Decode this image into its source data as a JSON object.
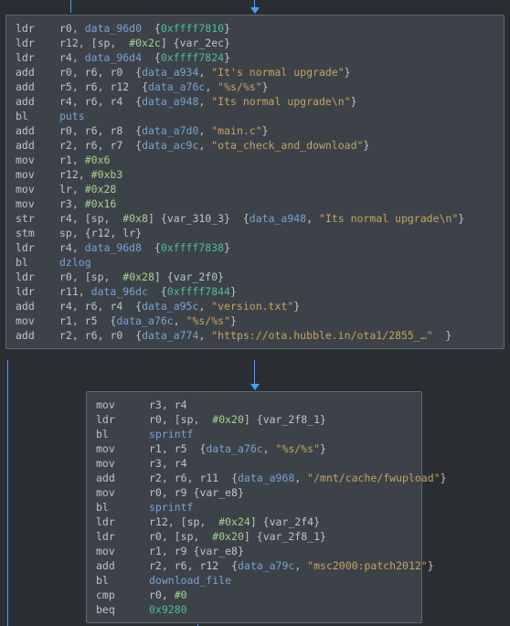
{
  "block1": {
    "lines": [
      {
        "m": "ldr",
        "ops": [
          {
            "t": "reg",
            "v": "r0"
          },
          {
            "t": "punc",
            "v": ", "
          },
          {
            "t": "data",
            "v": "data_96d0"
          },
          {
            "t": "punc",
            "v": "  {"
          },
          {
            "t": "addr",
            "v": "0xffff7810"
          },
          {
            "t": "punc",
            "v": "}"
          }
        ]
      },
      {
        "m": "ldr",
        "ops": [
          {
            "t": "reg",
            "v": "r12"
          },
          {
            "t": "punc",
            "v": ", ["
          },
          {
            "t": "reg",
            "v": "sp"
          },
          {
            "t": "punc",
            "v": ",  "
          },
          {
            "t": "num",
            "v": "#0x2c"
          },
          {
            "t": "punc",
            "v": "] {"
          },
          {
            "t": "var",
            "v": "var_2ec"
          },
          {
            "t": "punc",
            "v": "}"
          }
        ]
      },
      {
        "m": "ldr",
        "ops": [
          {
            "t": "reg",
            "v": "r4"
          },
          {
            "t": "punc",
            "v": ", "
          },
          {
            "t": "data",
            "v": "data_96d4"
          },
          {
            "t": "punc",
            "v": "  {"
          },
          {
            "t": "addr",
            "v": "0xffff7824"
          },
          {
            "t": "punc",
            "v": "}"
          }
        ]
      },
      {
        "m": "add",
        "ops": [
          {
            "t": "reg",
            "v": "r0"
          },
          {
            "t": "punc",
            "v": ", "
          },
          {
            "t": "reg",
            "v": "r6"
          },
          {
            "t": "punc",
            "v": ", "
          },
          {
            "t": "reg",
            "v": "r0"
          },
          {
            "t": "punc",
            "v": "  {"
          },
          {
            "t": "data",
            "v": "data_a934"
          },
          {
            "t": "punc",
            "v": ", "
          },
          {
            "t": "str",
            "v": "\"It's normal upgrade\""
          },
          {
            "t": "punc",
            "v": "}"
          }
        ]
      },
      {
        "m": "add",
        "ops": [
          {
            "t": "reg",
            "v": "r5"
          },
          {
            "t": "punc",
            "v": ", "
          },
          {
            "t": "reg",
            "v": "r6"
          },
          {
            "t": "punc",
            "v": ", "
          },
          {
            "t": "reg",
            "v": "r12"
          },
          {
            "t": "punc",
            "v": "  {"
          },
          {
            "t": "data",
            "v": "data_a76c"
          },
          {
            "t": "punc",
            "v": ", "
          },
          {
            "t": "str",
            "v": "\"%s/%s\""
          },
          {
            "t": "punc",
            "v": "}"
          }
        ]
      },
      {
        "m": "add",
        "ops": [
          {
            "t": "reg",
            "v": "r4"
          },
          {
            "t": "punc",
            "v": ", "
          },
          {
            "t": "reg",
            "v": "r6"
          },
          {
            "t": "punc",
            "v": ", "
          },
          {
            "t": "reg",
            "v": "r4"
          },
          {
            "t": "punc",
            "v": "  {"
          },
          {
            "t": "data",
            "v": "data_a948"
          },
          {
            "t": "punc",
            "v": ", "
          },
          {
            "t": "str",
            "v": "\"Its normal upgrade\\n\""
          },
          {
            "t": "punc",
            "v": "}"
          }
        ]
      },
      {
        "m": "bl",
        "ops": [
          {
            "t": "call",
            "v": "puts"
          }
        ]
      },
      {
        "m": "add",
        "ops": [
          {
            "t": "reg",
            "v": "r0"
          },
          {
            "t": "punc",
            "v": ", "
          },
          {
            "t": "reg",
            "v": "r6"
          },
          {
            "t": "punc",
            "v": ", "
          },
          {
            "t": "reg",
            "v": "r8"
          },
          {
            "t": "punc",
            "v": "  {"
          },
          {
            "t": "data",
            "v": "data_a7d0"
          },
          {
            "t": "punc",
            "v": ", "
          },
          {
            "t": "str",
            "v": "\"main.c\""
          },
          {
            "t": "punc",
            "v": "}"
          }
        ]
      },
      {
        "m": "add",
        "ops": [
          {
            "t": "reg",
            "v": "r2"
          },
          {
            "t": "punc",
            "v": ", "
          },
          {
            "t": "reg",
            "v": "r6"
          },
          {
            "t": "punc",
            "v": ", "
          },
          {
            "t": "reg",
            "v": "r7"
          },
          {
            "t": "punc",
            "v": "  {"
          },
          {
            "t": "data",
            "v": "data_ac9c"
          },
          {
            "t": "punc",
            "v": ", "
          },
          {
            "t": "str",
            "v": "\"ota_check_and_download\""
          },
          {
            "t": "punc",
            "v": "}"
          }
        ]
      },
      {
        "m": "mov",
        "ops": [
          {
            "t": "reg",
            "v": "r1"
          },
          {
            "t": "punc",
            "v": ", "
          },
          {
            "t": "num",
            "v": "#0x6"
          }
        ]
      },
      {
        "m": "mov",
        "ops": [
          {
            "t": "reg",
            "v": "r12"
          },
          {
            "t": "punc",
            "v": ", "
          },
          {
            "t": "num",
            "v": "#0xb3"
          }
        ]
      },
      {
        "m": "mov",
        "ops": [
          {
            "t": "reg",
            "v": "lr"
          },
          {
            "t": "punc",
            "v": ", "
          },
          {
            "t": "num",
            "v": "#0x28"
          }
        ]
      },
      {
        "m": "mov",
        "ops": [
          {
            "t": "reg",
            "v": "r3"
          },
          {
            "t": "punc",
            "v": ", "
          },
          {
            "t": "num",
            "v": "#0x16"
          }
        ]
      },
      {
        "m": "str",
        "ops": [
          {
            "t": "reg",
            "v": "r4"
          },
          {
            "t": "punc",
            "v": ", ["
          },
          {
            "t": "reg",
            "v": "sp"
          },
          {
            "t": "punc",
            "v": ",  "
          },
          {
            "t": "num",
            "v": "#0x8"
          },
          {
            "t": "punc",
            "v": "] {"
          },
          {
            "t": "var",
            "v": "var_310_3"
          },
          {
            "t": "punc",
            "v": "}  {"
          },
          {
            "t": "data",
            "v": "data_a948"
          },
          {
            "t": "punc",
            "v": ", "
          },
          {
            "t": "str",
            "v": "\"Its normal upgrade\\n\""
          },
          {
            "t": "punc",
            "v": "}"
          }
        ]
      },
      {
        "m": "stm",
        "ops": [
          {
            "t": "reg",
            "v": "sp"
          },
          {
            "t": "punc",
            "v": ", {"
          },
          {
            "t": "reg",
            "v": "r12"
          },
          {
            "t": "punc",
            "v": ", "
          },
          {
            "t": "reg",
            "v": "lr"
          },
          {
            "t": "punc",
            "v": "}"
          }
        ]
      },
      {
        "m": "ldr",
        "ops": [
          {
            "t": "reg",
            "v": "r4"
          },
          {
            "t": "punc",
            "v": ", "
          },
          {
            "t": "data",
            "v": "data_96d8"
          },
          {
            "t": "punc",
            "v": "  {"
          },
          {
            "t": "addr",
            "v": "0xffff7838"
          },
          {
            "t": "punc",
            "v": "}"
          }
        ]
      },
      {
        "m": "bl",
        "ops": [
          {
            "t": "call",
            "v": "dzlog"
          }
        ]
      },
      {
        "m": "ldr",
        "ops": [
          {
            "t": "reg",
            "v": "r0"
          },
          {
            "t": "punc",
            "v": ", ["
          },
          {
            "t": "reg",
            "v": "sp"
          },
          {
            "t": "punc",
            "v": ",  "
          },
          {
            "t": "num",
            "v": "#0x28"
          },
          {
            "t": "punc",
            "v": "] {"
          },
          {
            "t": "var",
            "v": "var_2f0"
          },
          {
            "t": "punc",
            "v": "}"
          }
        ]
      },
      {
        "m": "ldr",
        "ops": [
          {
            "t": "reg",
            "v": "r11"
          },
          {
            "t": "punc",
            "v": ", "
          },
          {
            "t": "data",
            "v": "data_96dc"
          },
          {
            "t": "punc",
            "v": "  {"
          },
          {
            "t": "addr",
            "v": "0xffff7844"
          },
          {
            "t": "punc",
            "v": "}"
          }
        ]
      },
      {
        "m": "add",
        "ops": [
          {
            "t": "reg",
            "v": "r4"
          },
          {
            "t": "punc",
            "v": ", "
          },
          {
            "t": "reg",
            "v": "r6"
          },
          {
            "t": "punc",
            "v": ", "
          },
          {
            "t": "reg",
            "v": "r4"
          },
          {
            "t": "punc",
            "v": "  {"
          },
          {
            "t": "data",
            "v": "data_a95c"
          },
          {
            "t": "punc",
            "v": ", "
          },
          {
            "t": "str",
            "v": "\"version.txt\""
          },
          {
            "t": "punc",
            "v": "}"
          }
        ]
      },
      {
        "m": "mov",
        "ops": [
          {
            "t": "reg",
            "v": "r1"
          },
          {
            "t": "punc",
            "v": ", "
          },
          {
            "t": "reg",
            "v": "r5"
          },
          {
            "t": "punc",
            "v": "  {"
          },
          {
            "t": "data",
            "v": "data_a76c"
          },
          {
            "t": "punc",
            "v": ", "
          },
          {
            "t": "str",
            "v": "\"%s/%s\""
          },
          {
            "t": "punc",
            "v": "}"
          }
        ]
      },
      {
        "m": "add",
        "ops": [
          {
            "t": "reg",
            "v": "r2"
          },
          {
            "t": "punc",
            "v": ", "
          },
          {
            "t": "reg",
            "v": "r6"
          },
          {
            "t": "punc",
            "v": ", "
          },
          {
            "t": "reg",
            "v": "r0"
          },
          {
            "t": "punc",
            "v": "  {"
          },
          {
            "t": "data",
            "v": "data_a774"
          },
          {
            "t": "punc",
            "v": ", "
          },
          {
            "t": "str",
            "v": "\"https://ota.hubble.in/ota1/2855_…\""
          },
          {
            "t": "punc",
            "v": "  }"
          }
        ]
      }
    ]
  },
  "block2": {
    "lines": [
      {
        "m": "mov",
        "ops": [
          {
            "t": "reg",
            "v": "r3"
          },
          {
            "t": "punc",
            "v": ", "
          },
          {
            "t": "reg",
            "v": "r4"
          }
        ]
      },
      {
        "m": "ldr",
        "ops": [
          {
            "t": "reg",
            "v": "r0"
          },
          {
            "t": "punc",
            "v": ", ["
          },
          {
            "t": "reg",
            "v": "sp"
          },
          {
            "t": "punc",
            "v": ",  "
          },
          {
            "t": "num",
            "v": "#0x20"
          },
          {
            "t": "punc",
            "v": "] {"
          },
          {
            "t": "var",
            "v": "var_2f8_1"
          },
          {
            "t": "punc",
            "v": "}"
          }
        ]
      },
      {
        "m": "bl",
        "ops": [
          {
            "t": "call",
            "v": "sprintf"
          }
        ]
      },
      {
        "m": "mov",
        "ops": [
          {
            "t": "reg",
            "v": "r1"
          },
          {
            "t": "punc",
            "v": ", "
          },
          {
            "t": "reg",
            "v": "r5"
          },
          {
            "t": "punc",
            "v": "  {"
          },
          {
            "t": "data",
            "v": "data_a76c"
          },
          {
            "t": "punc",
            "v": ", "
          },
          {
            "t": "str",
            "v": "\"%s/%s\""
          },
          {
            "t": "punc",
            "v": "}"
          }
        ]
      },
      {
        "m": "mov",
        "ops": [
          {
            "t": "reg",
            "v": "r3"
          },
          {
            "t": "punc",
            "v": ", "
          },
          {
            "t": "reg",
            "v": "r4"
          }
        ]
      },
      {
        "m": "add",
        "ops": [
          {
            "t": "reg",
            "v": "r2"
          },
          {
            "t": "punc",
            "v": ", "
          },
          {
            "t": "reg",
            "v": "r6"
          },
          {
            "t": "punc",
            "v": ", "
          },
          {
            "t": "reg",
            "v": "r11"
          },
          {
            "t": "punc",
            "v": "  {"
          },
          {
            "t": "data",
            "v": "data_a968"
          },
          {
            "t": "punc",
            "v": ", "
          },
          {
            "t": "str",
            "v": "\"/mnt/cache/fwupload\""
          },
          {
            "t": "punc",
            "v": "}"
          }
        ]
      },
      {
        "m": "mov",
        "ops": [
          {
            "t": "reg",
            "v": "r0"
          },
          {
            "t": "punc",
            "v": ", "
          },
          {
            "t": "reg",
            "v": "r9"
          },
          {
            "t": "punc",
            "v": " {"
          },
          {
            "t": "var",
            "v": "var_e8"
          },
          {
            "t": "punc",
            "v": "}"
          }
        ]
      },
      {
        "m": "bl",
        "ops": [
          {
            "t": "call",
            "v": "sprintf"
          }
        ]
      },
      {
        "m": "ldr",
        "ops": [
          {
            "t": "reg",
            "v": "r12"
          },
          {
            "t": "punc",
            "v": ", ["
          },
          {
            "t": "reg",
            "v": "sp"
          },
          {
            "t": "punc",
            "v": ",  "
          },
          {
            "t": "num",
            "v": "#0x24"
          },
          {
            "t": "punc",
            "v": "] {"
          },
          {
            "t": "var",
            "v": "var_2f4"
          },
          {
            "t": "punc",
            "v": "}"
          }
        ]
      },
      {
        "m": "ldr",
        "ops": [
          {
            "t": "reg",
            "v": "r0"
          },
          {
            "t": "punc",
            "v": ", ["
          },
          {
            "t": "reg",
            "v": "sp"
          },
          {
            "t": "punc",
            "v": ",  "
          },
          {
            "t": "num",
            "v": "#0x20"
          },
          {
            "t": "punc",
            "v": "] {"
          },
          {
            "t": "var",
            "v": "var_2f8_1"
          },
          {
            "t": "punc",
            "v": "}"
          }
        ]
      },
      {
        "m": "mov",
        "ops": [
          {
            "t": "reg",
            "v": "r1"
          },
          {
            "t": "punc",
            "v": ", "
          },
          {
            "t": "reg",
            "v": "r9"
          },
          {
            "t": "punc",
            "v": " {"
          },
          {
            "t": "var",
            "v": "var_e8"
          },
          {
            "t": "punc",
            "v": "}"
          }
        ]
      },
      {
        "m": "add",
        "ops": [
          {
            "t": "reg",
            "v": "r2"
          },
          {
            "t": "punc",
            "v": ", "
          },
          {
            "t": "reg",
            "v": "r6"
          },
          {
            "t": "punc",
            "v": ", "
          },
          {
            "t": "reg",
            "v": "r12"
          },
          {
            "t": "punc",
            "v": "  {"
          },
          {
            "t": "data",
            "v": "data_a79c"
          },
          {
            "t": "punc",
            "v": ", "
          },
          {
            "t": "str",
            "v": "\"msc2000:patch2012\""
          },
          {
            "t": "punc",
            "v": "}"
          }
        ]
      },
      {
        "m": "bl",
        "ops": [
          {
            "t": "call",
            "v": "download_file"
          }
        ]
      },
      {
        "m": "cmp",
        "ops": [
          {
            "t": "reg",
            "v": "r0"
          },
          {
            "t": "punc",
            "v": ", "
          },
          {
            "t": "num",
            "v": "#0"
          }
        ]
      },
      {
        "m": "beq",
        "ops": [
          {
            "t": "addr",
            "v": "0x9280"
          }
        ]
      }
    ]
  }
}
